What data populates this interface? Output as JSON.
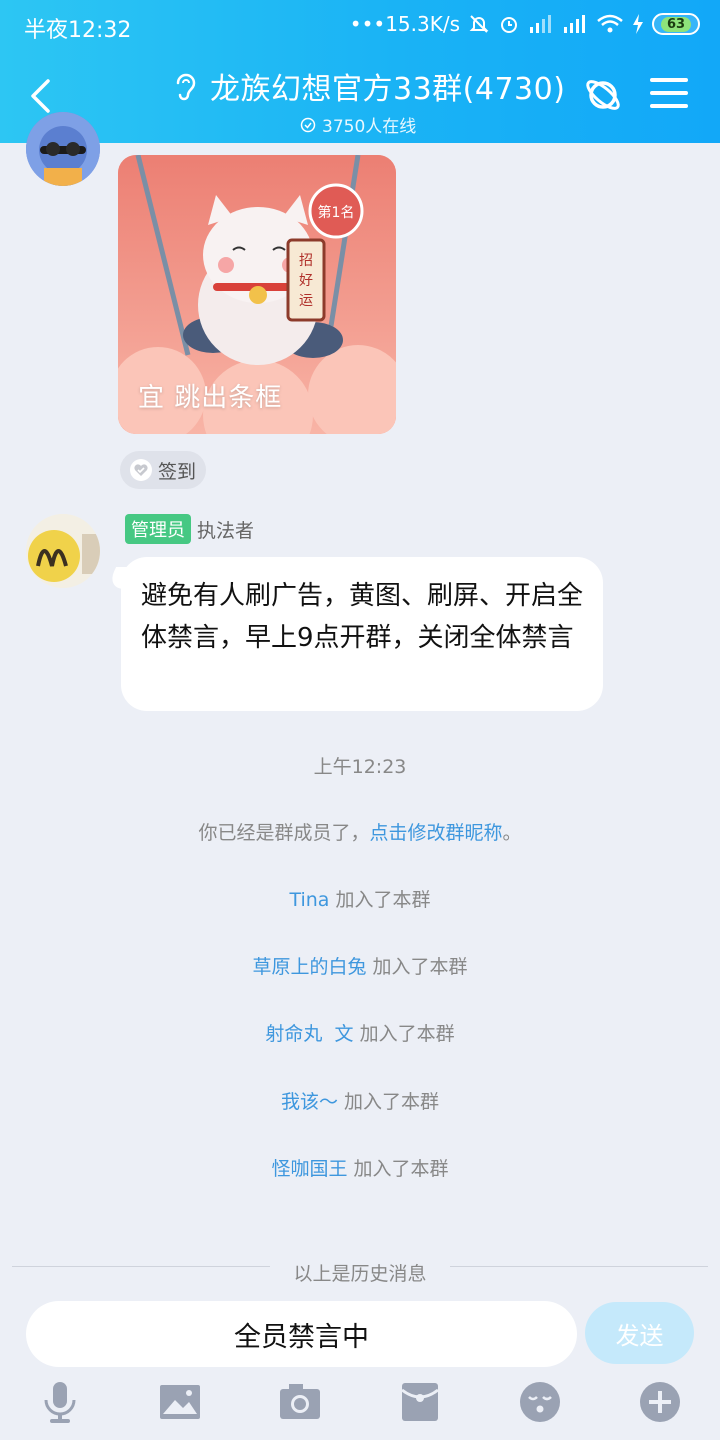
{
  "status_bar": {
    "time": "半夜12:32",
    "network_speed": "•••15.3K/s",
    "battery_level": "63"
  },
  "header": {
    "title": "龙族幻想官方33群(4730)",
    "online_count": "3750人在线"
  },
  "messages": {
    "image_caption": "宜 跳出条框",
    "signin_label": "签到",
    "admin_badge": "管理员",
    "admin_name": "执法者",
    "admin_text": "避免有人刷广告，黄图、刷屏、开启全体禁言，早上9点开群，关闭全体禁言",
    "timestamp": "上午12:23",
    "member_notice_prefix": "你已经是群成员了，",
    "member_notice_link": "点击修改群昵称",
    "member_notice_suffix": "。",
    "join_suffix": "加入了本群",
    "joins": [
      "Tina",
      "草原上的白兔",
      "射命丸  文",
      "我该～",
      "怪咖国王"
    ],
    "history_label": "以上是历史消息"
  },
  "input": {
    "placeholder": "全员禁言中",
    "send_label": "发送"
  },
  "toolbar": {
    "icons": [
      "microphone-icon",
      "image-icon",
      "camera-icon",
      "red-packet-icon",
      "emoji-icon",
      "plus-icon"
    ]
  },
  "colors": {
    "header_start": "#2dc6f3",
    "header_end": "#12a8f8",
    "link": "#3e97de",
    "admin_badge": "#46c883",
    "background": "#eceff6"
  }
}
